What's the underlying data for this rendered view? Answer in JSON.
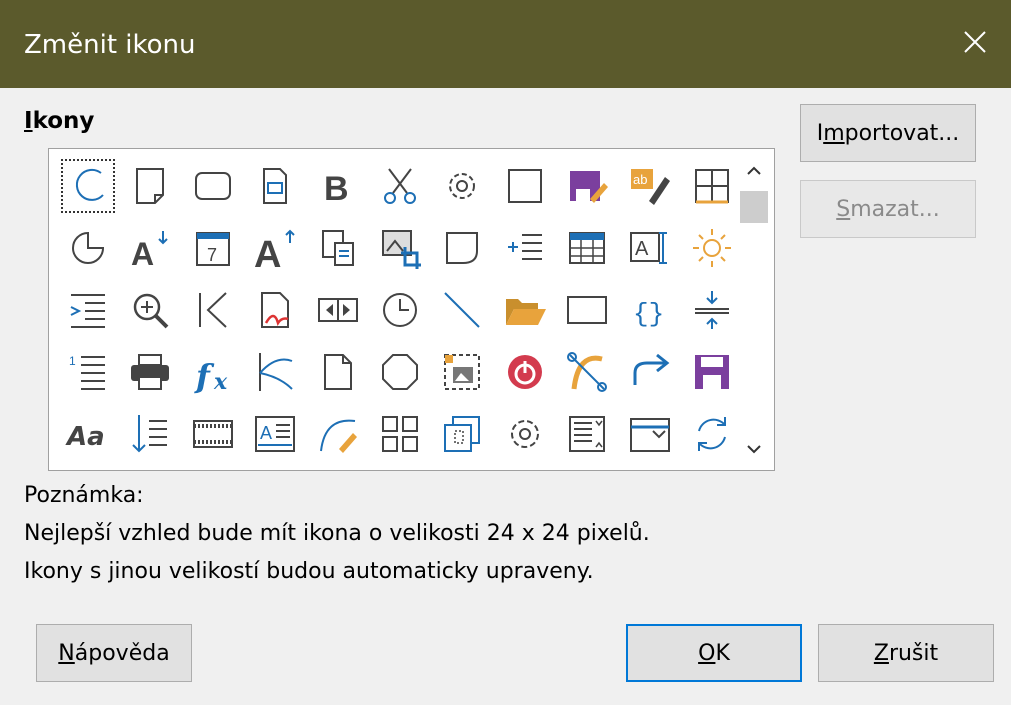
{
  "dialog": {
    "title": "Změnit ikonu",
    "icons_label_first": "I",
    "icons_label_rest": "kony"
  },
  "buttons": {
    "import": {
      "pre": "I",
      "u": "m",
      "post": "portovat..."
    },
    "delete": {
      "pre": "",
      "u": "S",
      "post": "mazat..."
    },
    "help": {
      "pre": "",
      "u": "N",
      "post": "ápověda"
    },
    "ok": {
      "pre": "",
      "u": "O",
      "post": "K"
    },
    "cancel": {
      "pre": "",
      "u": "Z",
      "post": "rušit"
    }
  },
  "note": {
    "heading": "Poznámka:",
    "line1": "Nejlepší vzhled bude mít ikona o velikosti 24 x 24 pixelů.",
    "line2": "Ikony s jinou velikostí budou automaticky upraveny."
  },
  "icons": [
    [
      "ellipse-arc-icon",
      "note-page-icon",
      "rounded-rect-icon",
      "form-field-icon",
      "bold-icon",
      "scissors-icon",
      "gear-icon",
      "square-icon",
      "save-as-icon",
      "edit-text-icon",
      "table-grid-icon"
    ],
    [
      "pie-chart-icon",
      "font-size-down-icon",
      "calendar-icon",
      "font-size-up-icon",
      "paste-special-icon",
      "image-crop-icon",
      "folded-shape-icon",
      "insert-list-icon",
      "table-icon",
      "text-field-icon",
      "sun-icon"
    ],
    [
      "indent-icon",
      "zoom-in-icon",
      "first-page-icon",
      "pdf-export-icon",
      "media-controls-icon",
      "clock-icon",
      "diagonal-line-icon",
      "folder-open-icon",
      "rectangle-icon",
      "braces-icon",
      "spacing-icon"
    ],
    [
      "numbered-list-icon",
      "printer-icon",
      "function-icon",
      "freeform-curve-icon",
      "blank-page-icon",
      "octagon-icon",
      "image-frame-icon",
      "power-icon",
      "bezier-icon",
      "redo-icon",
      "save-icon"
    ],
    [
      "font-style-icon",
      "sort-icon",
      "film-frame-icon",
      "text-box-icon",
      "curve-edit-icon",
      "layout-icon",
      "group-icon",
      "gear-outline-icon",
      "form-list-icon",
      "dropdown-icon",
      "circular-arrows-icon"
    ]
  ],
  "colors": {
    "titlebar": "#5b5a2c",
    "accent_blue": "#1d6fb5",
    "accent_purple": "#7b3f9e",
    "accent_orange": "#e8a33c",
    "accent_red": "#d33b4e"
  }
}
